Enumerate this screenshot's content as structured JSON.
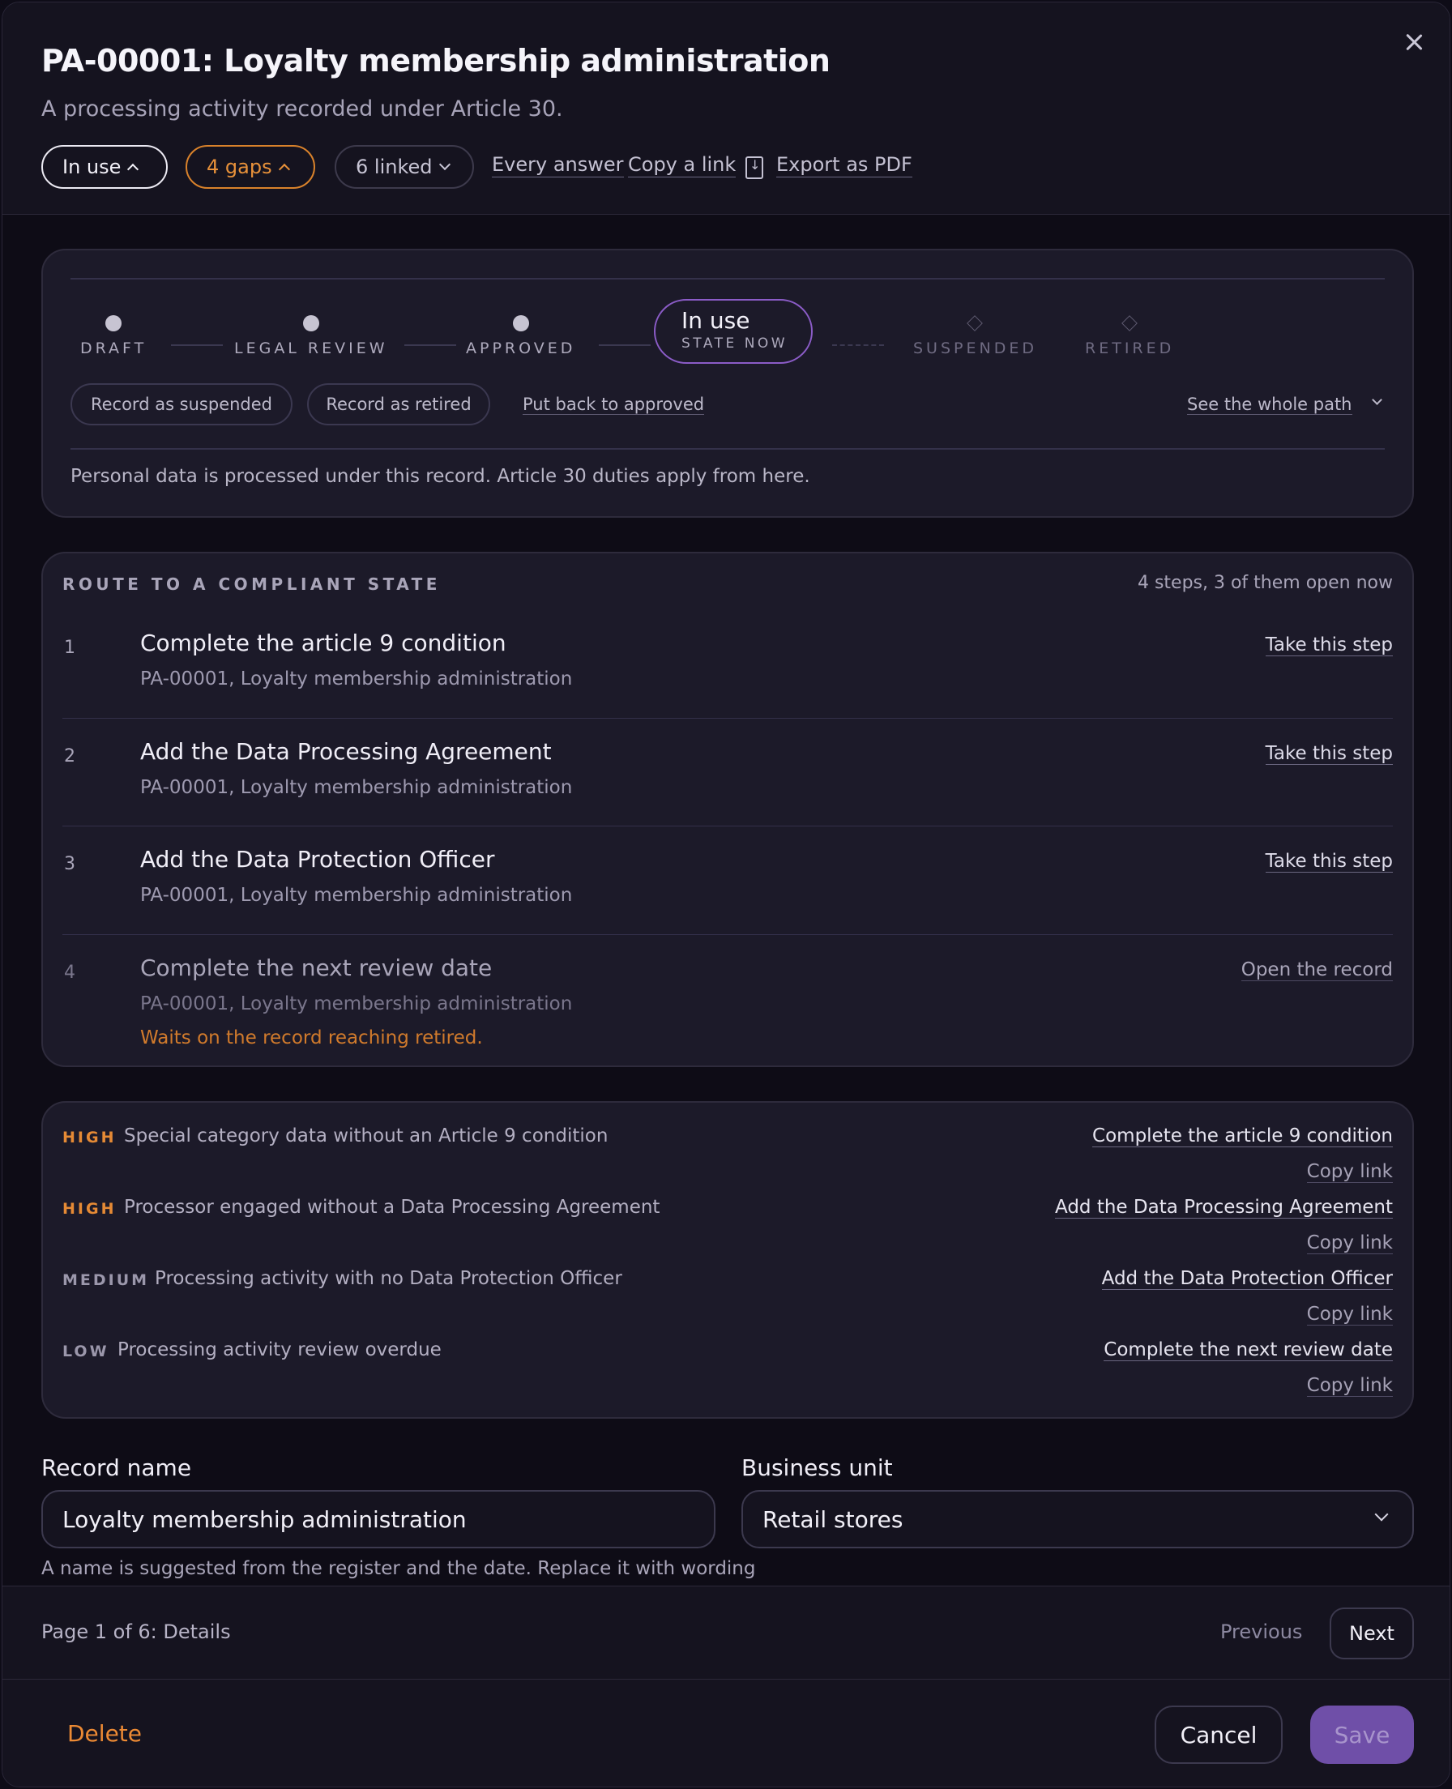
{
  "header": {
    "title": "PA-00001: Loyalty membership administration",
    "subtitle": "A processing activity recorded under Article 30.",
    "status_chip": "In use",
    "gaps_chip": "4 gaps",
    "linked_chip": "6 linked",
    "links": {
      "every_answer": "Every answer",
      "copy_link": "Copy a link",
      "export_pdf": "Export as PDF"
    },
    "icons": {
      "close": "close-icon",
      "export": "document-download-icon"
    }
  },
  "lifecycle": {
    "stages": [
      "DRAFT",
      "LEGAL REVIEW",
      "APPROVED"
    ],
    "current": {
      "name": "In use",
      "tag": "STATE NOW"
    },
    "future": [
      "SUSPENDED",
      "RETIRED"
    ],
    "actions": {
      "suspend": "Record as suspended",
      "retire": "Record as retired",
      "back": "Put back to approved",
      "path": "See the whole path"
    },
    "note": "Personal data is processed under this record. Article 30 duties apply from here."
  },
  "route": {
    "label": "ROUTE TO A COMPLIANT STATE",
    "count": "4 steps, 3 of them open now",
    "steps": [
      {
        "num": "1",
        "title": "Complete the article 9 condition",
        "sub": "PA-00001, Loyalty membership administration",
        "action": "Take this step"
      },
      {
        "num": "2",
        "title": "Add the Data Processing Agreement",
        "sub": "PA-00001, Loyalty membership administration",
        "action": "Take this step"
      },
      {
        "num": "3",
        "title": "Add the Data Protection Officer",
        "sub": "PA-00001, Loyalty membership administration",
        "action": "Take this step"
      },
      {
        "num": "4",
        "title": "Complete the next review date",
        "sub": "PA-00001, Loyalty membership administration",
        "action": "Open the record",
        "wait": "Waits on the record reaching retired."
      }
    ]
  },
  "gaps": [
    {
      "severity": "HIGH",
      "text": "Special category data without an Article 9 condition",
      "fix": "Complete the article 9 condition",
      "copy": "Copy link"
    },
    {
      "severity": "HIGH",
      "text": "Processor engaged without a Data Processing Agreement",
      "fix": "Add the Data Processing Agreement",
      "copy": "Copy link"
    },
    {
      "severity": "MEDIUM",
      "text": "Processing activity with no Data Protection Officer",
      "fix": "Add the Data Protection Officer",
      "copy": "Copy link"
    },
    {
      "severity": "LOW",
      "text": "Processing activity review overdue",
      "fix": "Complete the next review date",
      "copy": "Copy link"
    }
  ],
  "form": {
    "record_name_label": "Record name",
    "record_name_value": "Loyalty membership administration",
    "business_unit_label": "Business unit",
    "business_unit_value": "Retail stores",
    "help": "A name is suggested from the register and the date. Replace it with wording"
  },
  "pager": {
    "label": "Page 1 of 6: Details",
    "previous": "Previous",
    "next": "Next"
  },
  "footer": {
    "delete": "Delete",
    "cancel": "Cancel",
    "save": "Save"
  },
  "colors": {
    "accent_purple": "#6f4fa8",
    "warning_orange": "#e58a35"
  }
}
